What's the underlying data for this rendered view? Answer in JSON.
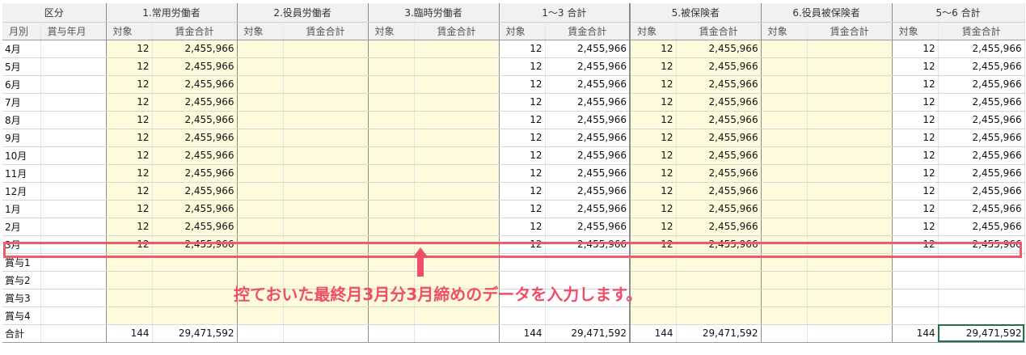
{
  "header": {
    "groups": [
      "区分",
      "1.常用労働者",
      "2.役員労働者",
      "3.臨時労働者",
      "1〜3 合計",
      "5.被保険者",
      "6.役員被保険者",
      "5〜6 合計"
    ],
    "sub": {
      "month": "月別",
      "bonus_month": "賞与年月",
      "count": "対象",
      "wage": "賃金合計"
    }
  },
  "rows": [
    {
      "label": "4月",
      "c1": "12",
      "w1": "2,455,966",
      "c13": "12",
      "w13": "2,455,966",
      "c5": "12",
      "w5": "2,455,966",
      "c56": "12",
      "w56": "2,455,966"
    },
    {
      "label": "5月",
      "c1": "12",
      "w1": "2,455,966",
      "c13": "12",
      "w13": "2,455,966",
      "c5": "12",
      "w5": "2,455,966",
      "c56": "12",
      "w56": "2,455,966"
    },
    {
      "label": "6月",
      "c1": "12",
      "w1": "2,455,966",
      "c13": "12",
      "w13": "2,455,966",
      "c5": "12",
      "w5": "2,455,966",
      "c56": "12",
      "w56": "2,455,966"
    },
    {
      "label": "7月",
      "c1": "12",
      "w1": "2,455,966",
      "c13": "12",
      "w13": "2,455,966",
      "c5": "12",
      "w5": "2,455,966",
      "c56": "12",
      "w56": "2,455,966"
    },
    {
      "label": "8月",
      "c1": "12",
      "w1": "2,455,966",
      "c13": "12",
      "w13": "2,455,966",
      "c5": "12",
      "w5": "2,455,966",
      "c56": "12",
      "w56": "2,455,966"
    },
    {
      "label": "9月",
      "c1": "12",
      "w1": "2,455,966",
      "c13": "12",
      "w13": "2,455,966",
      "c5": "12",
      "w5": "2,455,966",
      "c56": "12",
      "w56": "2,455,966"
    },
    {
      "label": "10月",
      "c1": "12",
      "w1": "2,455,966",
      "c13": "12",
      "w13": "2,455,966",
      "c5": "12",
      "w5": "2,455,966",
      "c56": "12",
      "w56": "2,455,966"
    },
    {
      "label": "11月",
      "c1": "12",
      "w1": "2,455,966",
      "c13": "12",
      "w13": "2,455,966",
      "c5": "12",
      "w5": "2,455,966",
      "c56": "12",
      "w56": "2,455,966"
    },
    {
      "label": "12月",
      "c1": "12",
      "w1": "2,455,966",
      "c13": "12",
      "w13": "2,455,966",
      "c5": "12",
      "w5": "2,455,966",
      "c56": "12",
      "w56": "2,455,966"
    },
    {
      "label": "1月",
      "c1": "12",
      "w1": "2,455,966",
      "c13": "12",
      "w13": "2,455,966",
      "c5": "12",
      "w5": "2,455,966",
      "c56": "12",
      "w56": "2,455,966"
    },
    {
      "label": "2月",
      "c1": "12",
      "w1": "2,455,966",
      "c13": "12",
      "w13": "2,455,966",
      "c5": "12",
      "w5": "2,455,966",
      "c56": "12",
      "w56": "2,455,966"
    },
    {
      "label": "3月",
      "c1": "12",
      "w1": "2,455,966",
      "c13": "12",
      "w13": "2,455,966",
      "c5": "12",
      "w5": "2,455,966",
      "c56": "12",
      "w56": "2,455,966"
    },
    {
      "label": "賞与1",
      "c1": "",
      "w1": "",
      "c13": "",
      "w13": "",
      "c5": "",
      "w5": "",
      "c56": "",
      "w56": ""
    },
    {
      "label": "賞与2",
      "c1": "",
      "w1": "",
      "c13": "",
      "w13": "",
      "c5": "",
      "w5": "",
      "c56": "",
      "w56": ""
    },
    {
      "label": "賞与3",
      "c1": "",
      "w1": "",
      "c13": "",
      "w13": "",
      "c5": "",
      "w5": "",
      "c56": "",
      "w56": ""
    },
    {
      "label": "賞与4",
      "c1": "",
      "w1": "",
      "c13": "",
      "w13": "",
      "c5": "",
      "w5": "",
      "c56": "",
      "w56": ""
    }
  ],
  "total": {
    "label": "合計",
    "c1": "144",
    "w1": "29,471,592",
    "c13": "144",
    "w13": "29,471,592",
    "c5": "144",
    "w5": "29,471,592",
    "c56": "144",
    "w56": "29,471,592"
  },
  "annotation": {
    "text": "控ておいた最終月3月分3月締めのデータを入力します。",
    "color": "#f04e68",
    "highlighted_row": "3月"
  },
  "colors": {
    "input_cell": "#fdfbdc",
    "header": "#f1f1f1",
    "selection": "#217346"
  }
}
